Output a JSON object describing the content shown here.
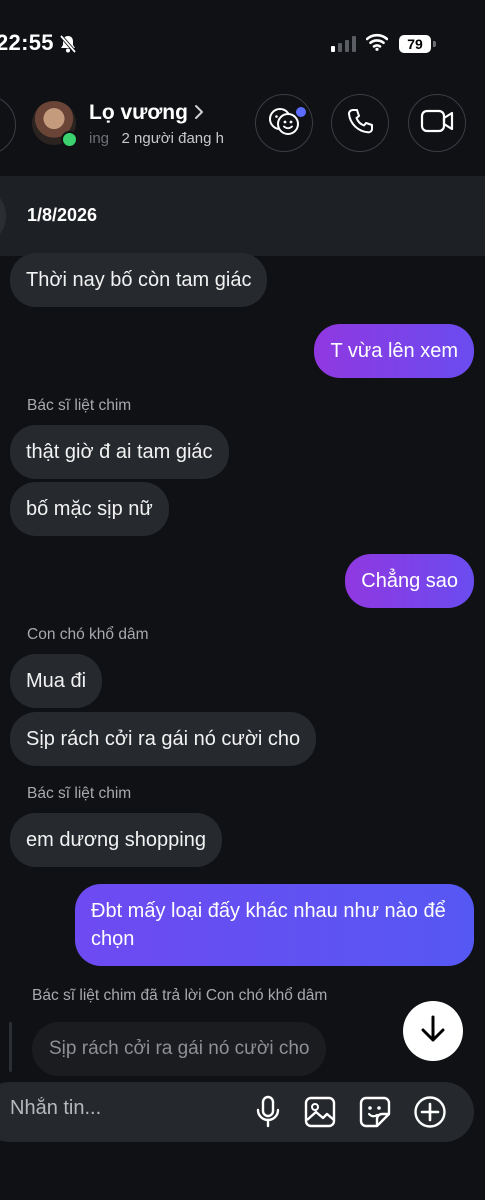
{
  "status_bar": {
    "time": "22:55",
    "battery": "79"
  },
  "header": {
    "contact_name": "Lọ vương",
    "status_prefix": "ing",
    "status_text": "2 người đang h"
  },
  "date_separator": "1/8/2026",
  "messages": [
    {
      "direction": "in",
      "text": "Thời nay bố còn tam giác"
    },
    {
      "direction": "out",
      "text": "T vừa lên xem"
    },
    {
      "sender": "Bác sĩ liệt chim",
      "direction": "in",
      "text": "thật giờ đ ai tam giác"
    },
    {
      "direction": "in",
      "text": "bố mặc sịp nữ"
    },
    {
      "direction": "out",
      "text": "Chẳng sao"
    },
    {
      "sender": "Con chó khổ dâm",
      "direction": "in",
      "text": "Mua đi"
    },
    {
      "direction": "in",
      "text": "Sịp rách cởi ra gái nó cười cho"
    },
    {
      "sender": "Bác sĩ liệt chim",
      "direction": "in",
      "text": "em dương shopping"
    },
    {
      "direction": "out",
      "text": "Đbt mấy loại đấy khác nhau như nào để chọn"
    }
  ],
  "reply": {
    "caption": "Bác sĩ liệt chim đã trả lời Con chó khổ dâm",
    "quoted_text": "Sịp rách cởi ra gái nó cười cho"
  },
  "composer": {
    "placeholder": "Nhắn tin..."
  },
  "colors": {
    "background": "#0f1114",
    "incoming_bubble": "#26292e",
    "outgoing_start": "#9038e0",
    "outgoing_end": "#6a4cf0",
    "online": "#3bd16f",
    "badge": "#5b6cff"
  },
  "icons": [
    "bell-off-icon",
    "signal-icon",
    "wifi-icon",
    "battery-icon",
    "back-icon",
    "chevron-right-icon",
    "theme-faces-icon",
    "phone-icon",
    "video-camera-icon",
    "arrow-down-icon",
    "microphone-icon",
    "image-icon",
    "sticker-icon",
    "plus-circle-icon"
  ]
}
